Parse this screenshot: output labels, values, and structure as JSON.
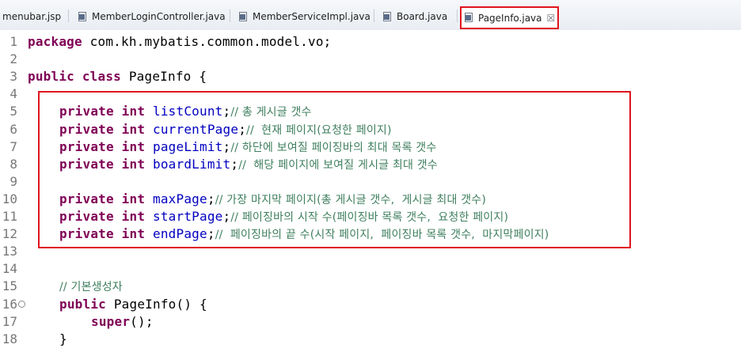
{
  "tabs": [
    {
      "label": "menubar.jsp",
      "active": false
    },
    {
      "label": "MemberLoginController.java",
      "active": false
    },
    {
      "label": "MemberServiceImpl.java",
      "active": false
    },
    {
      "label": "Board.java",
      "active": false
    },
    {
      "label": "PageInfo.java",
      "active": true
    }
  ],
  "close_glyph": "☒",
  "colors": {
    "keyword": "#7f0055",
    "field": "#0000c0",
    "comment": "#3f7f5f",
    "highlight": "#e0141e"
  },
  "editor": {
    "lines": [
      {
        "num": "1",
        "kw": "package",
        "rest": " com.kh.mybatis.common.model.vo;"
      },
      {
        "num": "2"
      },
      {
        "num": "3",
        "kw": "public class",
        "rest": " PageInfo {"
      },
      {
        "num": "4"
      },
      {
        "num": "5",
        "kw": "private int",
        "field": "listCount",
        "tail": ";",
        "comment": "// 총 게시글 갯수"
      },
      {
        "num": "6",
        "kw": "private int",
        "field": "currentPage",
        "tail": ";",
        "comment": "//  현재 페이지(요청한 페이지)"
      },
      {
        "num": "7",
        "kw": "private int",
        "field": "pageLimit",
        "tail": ";",
        "comment": "// 하단에 보여질 페이징바의 최대 목록 갯수"
      },
      {
        "num": "8",
        "kw": "private int",
        "field": "boardLimit",
        "tail": ";",
        "comment": "//  해당 페이지에 보여질 게시글 최대 갯수"
      },
      {
        "num": "9"
      },
      {
        "num": "10",
        "kw": "private int",
        "field": "maxPage",
        "tail": ";",
        "comment": "// 가장 마지막 페이지(총 게시글 갯수,  게시글 최대 갯수)"
      },
      {
        "num": "11",
        "kw": "private int",
        "field": "startPage",
        "tail": ";",
        "comment": "// 페이징바의 시작 수(페이징바 목록 갯수,  요청한 페이지)"
      },
      {
        "num": "12",
        "kw": "private int",
        "field": "endPage",
        "tail": ";",
        "comment": "//  페이징바의 끝 수(시작 페이지,  페이징바 목록 갯수,  마지막페이지)"
      },
      {
        "num": "13"
      },
      {
        "num": "14"
      },
      {
        "num": "15",
        "comment": "// 기본생성자"
      },
      {
        "num": "16",
        "kw": "public",
        "rest": " PageInfo() {",
        "fold": "⊖"
      },
      {
        "num": "17",
        "kw": "super",
        "rest": "();"
      },
      {
        "num": "18",
        "rest": "}"
      }
    ]
  }
}
